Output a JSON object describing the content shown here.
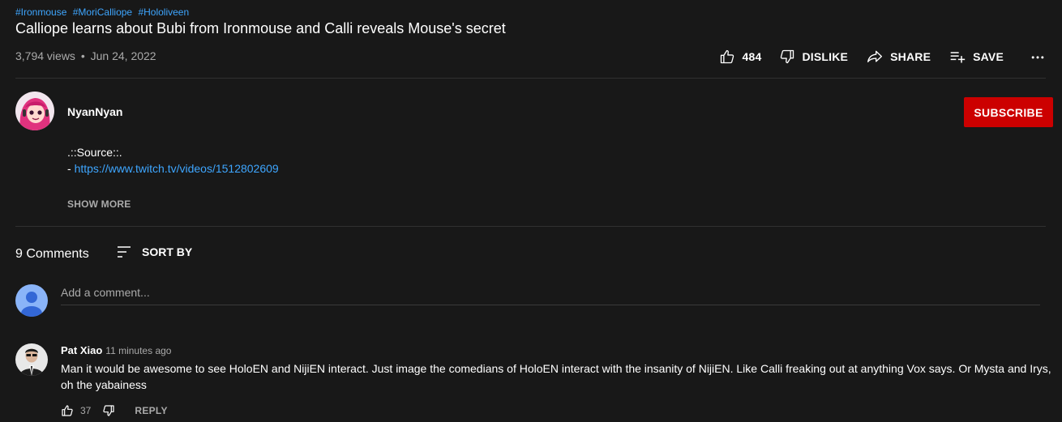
{
  "video": {
    "hashtags": [
      "#Ironmouse",
      "#MoriCalliope",
      "#Hololiveen"
    ],
    "title": "Calliope learns about Bubi from Ironmouse and Calli reveals Mouse's secret",
    "views": "3,794 views",
    "separator": "•",
    "date": "Jun 24, 2022"
  },
  "actions": {
    "like_count": "484",
    "dislike_label": "DISLIKE",
    "share_label": "SHARE",
    "save_label": "SAVE"
  },
  "channel": {
    "name": "NyanNyan",
    "subscribe_label": "SUBSCRIBE"
  },
  "description": {
    "line1": ".::Source::.",
    "line2_prefix": "- ",
    "link": "https://www.twitch.tv/videos/1512802609",
    "show_more": "SHOW MORE"
  },
  "comments": {
    "count_label": "9 Comments",
    "sort_label": "SORT BY",
    "add_placeholder": "Add a comment...",
    "items": [
      {
        "author": "Pat Xiao",
        "time": "11 minutes ago",
        "text": "Man it would be awesome to see HoloEN and NijiEN interact. Just image the comedians of HoloEN interact with the insanity of NijiEN. Like Calli freaking out at anything Vox says. Or Mysta and Irys, oh the yabainess",
        "likes": "37",
        "reply_label": "REPLY"
      }
    ]
  },
  "colors": {
    "background": "#181818",
    "link": "#3ea6ff",
    "subscribe": "#cc0000",
    "secondary_text": "#aaaaaa"
  },
  "icons": [
    "thumb-up-icon",
    "thumb-down-icon",
    "share-icon",
    "save-playlist-icon",
    "more-icon",
    "sort-icon"
  ]
}
